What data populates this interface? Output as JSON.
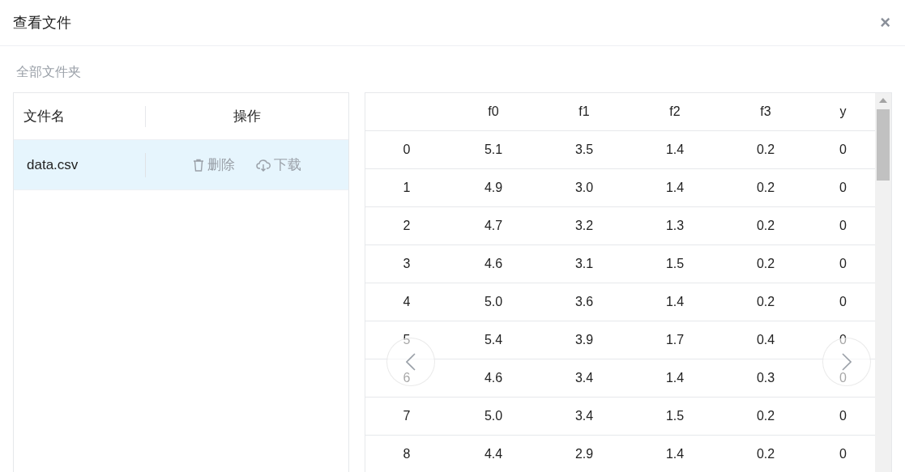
{
  "dialog": {
    "title": "查看文件",
    "close_label": "×"
  },
  "breadcrumb": "全部文件夹",
  "file_table": {
    "columns": [
      "文件名",
      "操作"
    ],
    "rows": [
      {
        "name": "data.csv",
        "selected": true,
        "actions": [
          {
            "kind": "delete",
            "label": "删除"
          },
          {
            "kind": "download",
            "label": "下载"
          }
        ]
      }
    ]
  },
  "preview_table": {
    "columns": [
      "",
      "f0",
      "f1",
      "f2",
      "f3",
      "y"
    ],
    "rows": [
      [
        "0",
        "5.1",
        "3.5",
        "1.4",
        "0.2",
        "0"
      ],
      [
        "1",
        "4.9",
        "3.0",
        "1.4",
        "0.2",
        "0"
      ],
      [
        "2",
        "4.7",
        "3.2",
        "1.3",
        "0.2",
        "0"
      ],
      [
        "3",
        "4.6",
        "3.1",
        "1.5",
        "0.2",
        "0"
      ],
      [
        "4",
        "5.0",
        "3.6",
        "1.4",
        "0.2",
        "0"
      ],
      [
        "5",
        "5.4",
        "3.9",
        "1.7",
        "0.4",
        "0"
      ],
      [
        "6",
        "4.6",
        "3.4",
        "1.4",
        "0.3",
        "0"
      ],
      [
        "7",
        "5.0",
        "3.4",
        "1.5",
        "0.2",
        "0"
      ],
      [
        "8",
        "4.4",
        "2.9",
        "1.4",
        "0.2",
        "0"
      ]
    ]
  }
}
